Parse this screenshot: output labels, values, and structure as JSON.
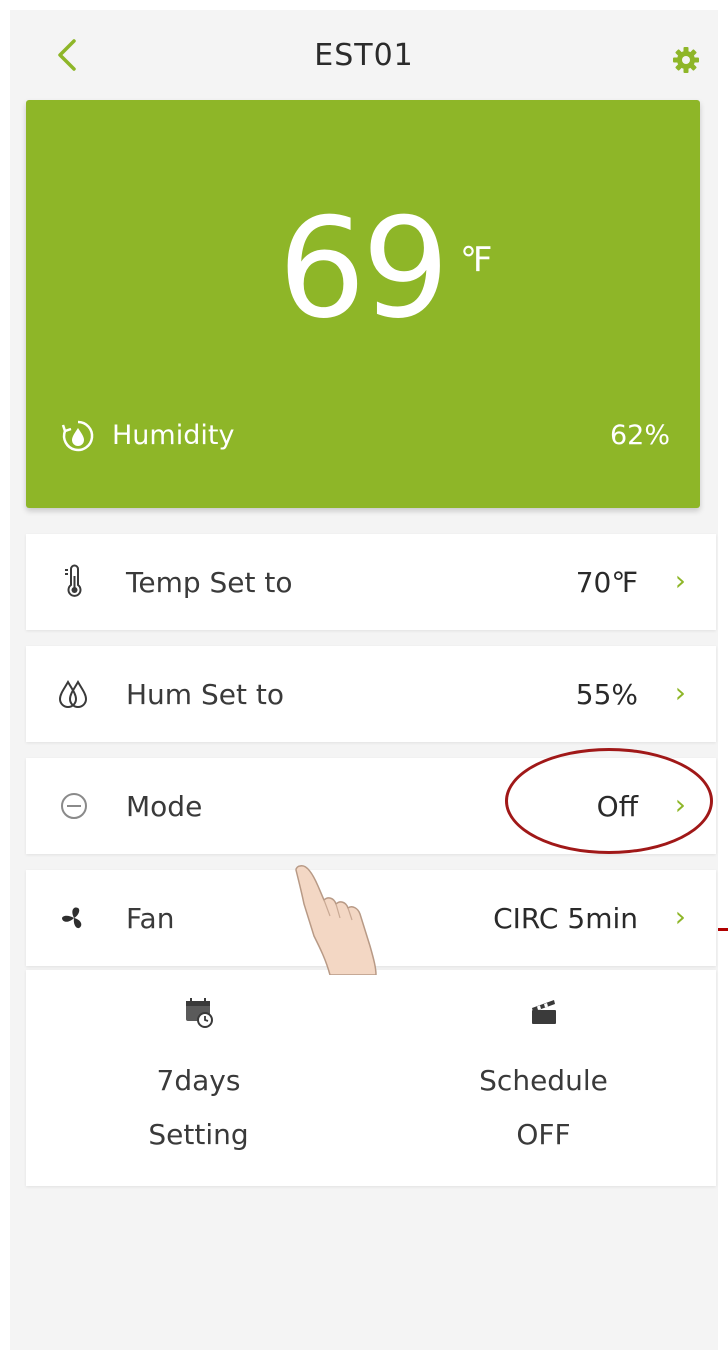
{
  "header": {
    "title": "EST01",
    "back_icon": "chevron-left-icon",
    "settings_icon": "gear-icon"
  },
  "hero": {
    "temperature": "69",
    "unit": "℉",
    "humidity_label": "Humidity",
    "humidity_value": "62%",
    "humidity_icon": "humidity-refresh-icon"
  },
  "rows": [
    {
      "label": "Temp Set to",
      "value": "70℉",
      "icon": "thermometer-icon"
    },
    {
      "label": "Hum Set to",
      "value": "55%",
      "icon": "water-drops-icon"
    },
    {
      "label": "Mode",
      "value": "Off",
      "icon": "minus-circle-icon"
    },
    {
      "label": "Fan",
      "value": "CIRC 5min",
      "icon": "fan-icon"
    }
  ],
  "tiles": [
    {
      "line1": "7days",
      "line2": "Setting",
      "icon": "calendar-clock-icon"
    },
    {
      "line1": "Schedule",
      "line2": "OFF",
      "icon": "clapperboard-icon"
    }
  ],
  "colors": {
    "accent": "#8eb628",
    "annotation": "#a01818"
  }
}
